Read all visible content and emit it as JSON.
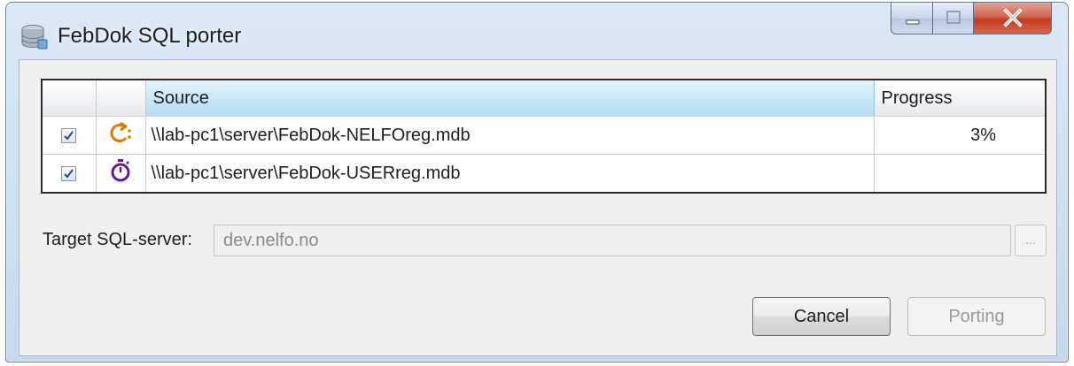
{
  "window": {
    "title": "FebDok SQL porter",
    "app_icon": "database-icon",
    "controls": [
      "minimize-icon",
      "maximize-icon",
      "close-icon"
    ]
  },
  "grid": {
    "columns": [
      "",
      "",
      "Source",
      "Progress"
    ],
    "rows": [
      {
        "checked": true,
        "status_icon": "refresh-running-icon",
        "status_color": "#e07a00",
        "source": "\\\\lab-pc1\\server\\FebDok-NELFOreg.mdb",
        "progress": "3%"
      },
      {
        "checked": true,
        "status_icon": "stopwatch-pending-icon",
        "status_color": "#5a1f8c",
        "source": "\\\\lab-pc1\\server\\FebDok-USERreg.mdb",
        "progress": ""
      }
    ]
  },
  "target": {
    "label": "Target SQL-server:",
    "value": "dev.nelfo.no",
    "browse_label": "..."
  },
  "buttons": {
    "cancel": "Cancel",
    "porting": "Porting"
  },
  "colors": {
    "titlebar": "#c6d9ee",
    "header_selected": "#c9e8f8",
    "close_button": "#c33a1f"
  }
}
